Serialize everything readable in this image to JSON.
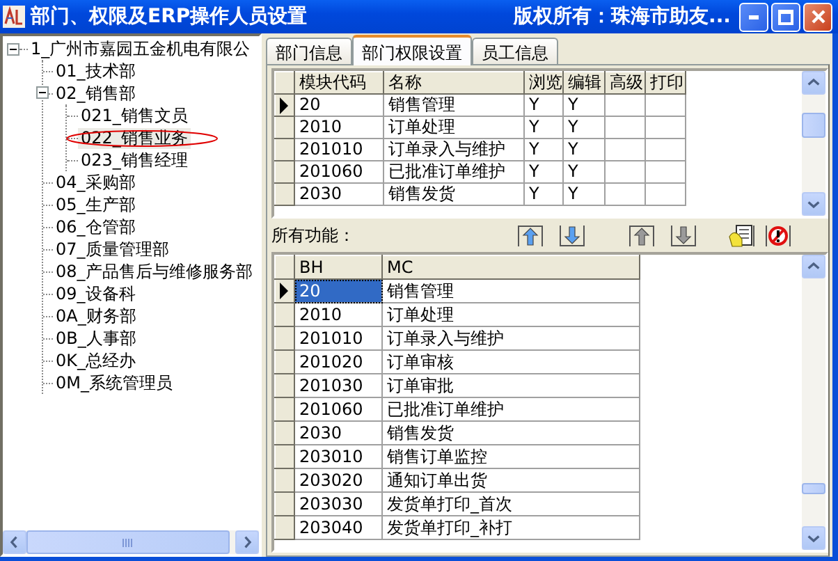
{
  "window": {
    "title": "部门、权限及ERP操作人员设置",
    "copyright": "版权所有：珠海市助友..."
  },
  "tree": {
    "items": [
      {
        "label": "1_广州市嘉园五金机电有限公",
        "expanded": true,
        "selected": false,
        "children": [
          {
            "label": "01_技术部",
            "selected": false
          },
          {
            "label": "02_销售部",
            "expanded": true,
            "selected": false,
            "children": [
              {
                "label": "021_销售文员",
                "selected": false
              },
              {
                "label": "022_销售业务",
                "selected": true
              },
              {
                "label": "023_销售经理",
                "selected": false
              }
            ]
          },
          {
            "label": "04_采购部",
            "selected": false
          },
          {
            "label": "05_生产部",
            "selected": false
          },
          {
            "label": "06_仓管部",
            "selected": false
          },
          {
            "label": "07_质量管理部",
            "selected": false
          },
          {
            "label": "08_产品售后与维修服务部",
            "selected": false
          },
          {
            "label": "09_设备科",
            "selected": false
          },
          {
            "label": "0A_财务部",
            "selected": false
          },
          {
            "label": "0B_人事部",
            "selected": false
          },
          {
            "label": "0K_总经办",
            "selected": false
          },
          {
            "label": "0M_系统管理员",
            "selected": false
          }
        ]
      }
    ]
  },
  "tabs": [
    {
      "label": "部门信息",
      "selected": false
    },
    {
      "label": "部门权限设置",
      "selected": true
    },
    {
      "label": "员工信息",
      "selected": false
    }
  ],
  "permissions_table": {
    "columns": [
      "模块代码",
      "名称",
      "浏览",
      "编辑",
      "高级",
      "打印"
    ],
    "rows": [
      {
        "selected": true,
        "cells": [
          "20",
          "销售管理",
          "Y",
          "Y"
        ]
      },
      {
        "selected": false,
        "cells": [
          "2010",
          "订单处理",
          "Y",
          "Y"
        ]
      },
      {
        "selected": false,
        "cells": [
          "201010",
          "订单录入与维护",
          "Y",
          "Y"
        ]
      },
      {
        "selected": false,
        "cells": [
          "201060",
          "已批准订单维护",
          "Y",
          "Y"
        ]
      },
      {
        "selected": false,
        "cells": [
          "2030",
          "销售发货",
          "Y",
          "Y"
        ]
      }
    ]
  },
  "toolbar": {
    "label": "所有功能："
  },
  "functions_table": {
    "columns": [
      "BH",
      "MC"
    ],
    "rows": [
      {
        "selected": true,
        "cells": [
          "20",
          "销售管理"
        ]
      },
      {
        "selected": false,
        "cells": [
          "2010",
          "订单处理"
        ]
      },
      {
        "selected": false,
        "cells": [
          "201010",
          "订单录入与维护"
        ]
      },
      {
        "selected": false,
        "cells": [
          "201020",
          "订单审核"
        ]
      },
      {
        "selected": false,
        "cells": [
          "201030",
          "订单审批"
        ]
      },
      {
        "selected": false,
        "cells": [
          "201060",
          "已批准订单维护"
        ]
      },
      {
        "selected": false,
        "cells": [
          "2030",
          "销售发货"
        ]
      },
      {
        "selected": false,
        "cells": [
          "203010",
          "销售订单监控"
        ]
      },
      {
        "selected": false,
        "cells": [
          "203020",
          "通知订单出货"
        ]
      },
      {
        "selected": false,
        "cells": [
          "203030",
          "发货单打印_首次"
        ]
      },
      {
        "selected": false,
        "cells": [
          "203040",
          "发货单打印_补打"
        ]
      }
    ]
  }
}
